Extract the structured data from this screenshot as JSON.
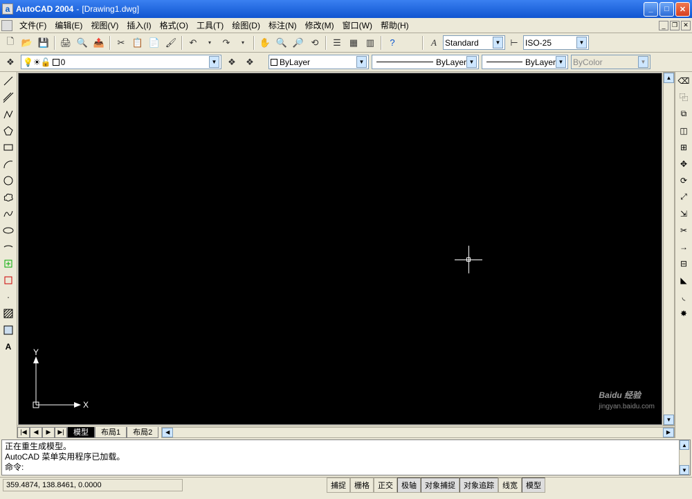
{
  "titlebar": {
    "app": "AutoCAD 2004",
    "sep": "-",
    "doc": "[Drawing1.dwg]"
  },
  "menu": {
    "items": [
      "文件(F)",
      "编辑(E)",
      "视图(V)",
      "插入(I)",
      "格式(O)",
      "工具(T)",
      "绘图(D)",
      "标注(N)",
      "修改(M)",
      "窗口(W)",
      "帮助(H)"
    ]
  },
  "std_toolbar": {
    "textstyle_label": "A",
    "textstyle": "Standard",
    "dimstyle": "ISO-25"
  },
  "layerbar": {
    "layer_combo": "0",
    "bylayer1": "ByLayer",
    "bylayer2": "ByLayer",
    "bylayer3": "ByLayer",
    "bycolor": "ByColor"
  },
  "tabs": {
    "nav": [
      "|◀",
      "◀",
      "▶",
      "▶|"
    ],
    "model": "模型",
    "layout1": "布局1",
    "layout2": "布局2"
  },
  "cmd": {
    "line1": "正在重生成模型。",
    "line2": "AutoCAD 菜单实用程序已加载。",
    "prompt": "命令:"
  },
  "status": {
    "coords": "359.4874, 138.8461, 0.0000",
    "buttons": [
      "捕捉",
      "栅格",
      "正交",
      "极轴",
      "对象捕捉",
      "对象追踪",
      "线宽",
      "模型"
    ]
  },
  "ucs": {
    "x": "X",
    "y": "Y"
  },
  "watermark": {
    "main": "Baidu 经验",
    "sub": "jingyan.baidu.com"
  }
}
